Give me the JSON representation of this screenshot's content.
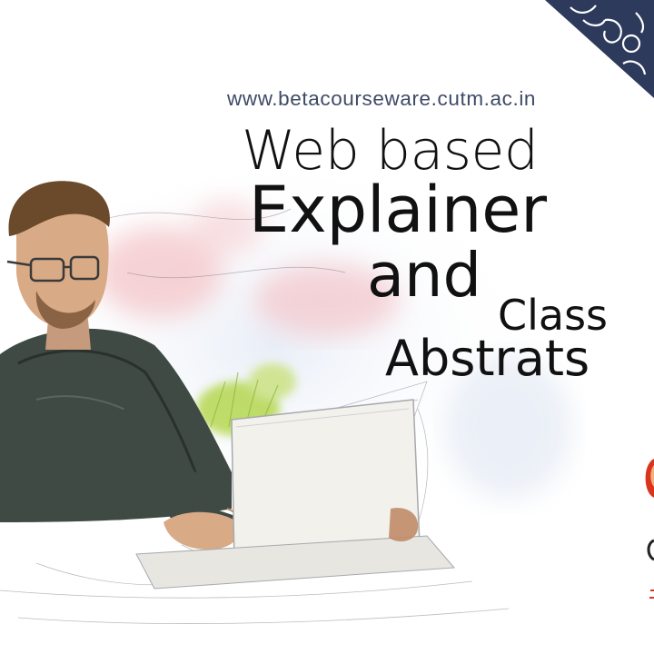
{
  "site_url": "www.betacourseware.cutm.ac.in",
  "headline": {
    "line1": "Web based",
    "line2": "Explainer",
    "line3": "and",
    "line4": "Class",
    "line5": "Abstrats"
  },
  "colors": {
    "url_text": "#3e4a66",
    "title_text": "#111111",
    "corner_logo": "#2d3a5c",
    "accent_red": "#d8341e"
  },
  "icons": [
    "university-logo-corner-icon",
    "man-with-laptop-illustration",
    "partial-logo-icon"
  ]
}
